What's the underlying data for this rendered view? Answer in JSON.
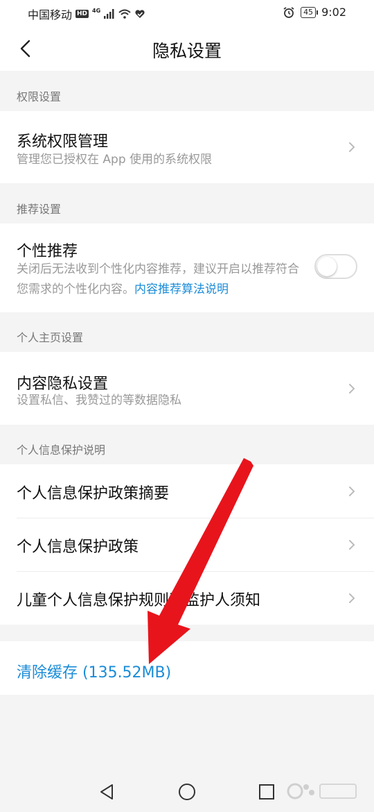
{
  "status_bar": {
    "carrier": "中国移动",
    "hd": "HD",
    "network": "4G",
    "battery": "45",
    "time": "9:02"
  },
  "header": {
    "title": "隐私设置"
  },
  "sections": {
    "permissions": {
      "header": "权限设置",
      "item_title": "系统权限管理",
      "item_subtitle": "管理您已授权在 App 使用的系统权限"
    },
    "recommend": {
      "header": "推荐设置",
      "item_title": "个性推荐",
      "item_desc": "关闭后无法收到个性化内容推荐，建议开启以推荐符合您需求的个性化内容。",
      "item_link": "内容推荐算法说明",
      "toggle_on": false
    },
    "homepage": {
      "header": "个人主页设置",
      "item_title": "内容隐私设置",
      "item_subtitle": "设置私信、我赞过的等数据隐私"
    },
    "info_protection": {
      "header": "个人信息保护说明",
      "items": [
        "个人信息保护政策摘要",
        "个人信息保护政策",
        "儿童个人信息保护规则及监护人须知"
      ]
    }
  },
  "cache": {
    "label": "清除缓存 (135.52MB)"
  },
  "nav_bar": {
    "icons": [
      "back-triangle-icon",
      "home-circle-icon",
      "recents-square-icon"
    ]
  },
  "colors": {
    "accent": "#1a8cd8",
    "annotation_arrow": "#e8141c"
  }
}
